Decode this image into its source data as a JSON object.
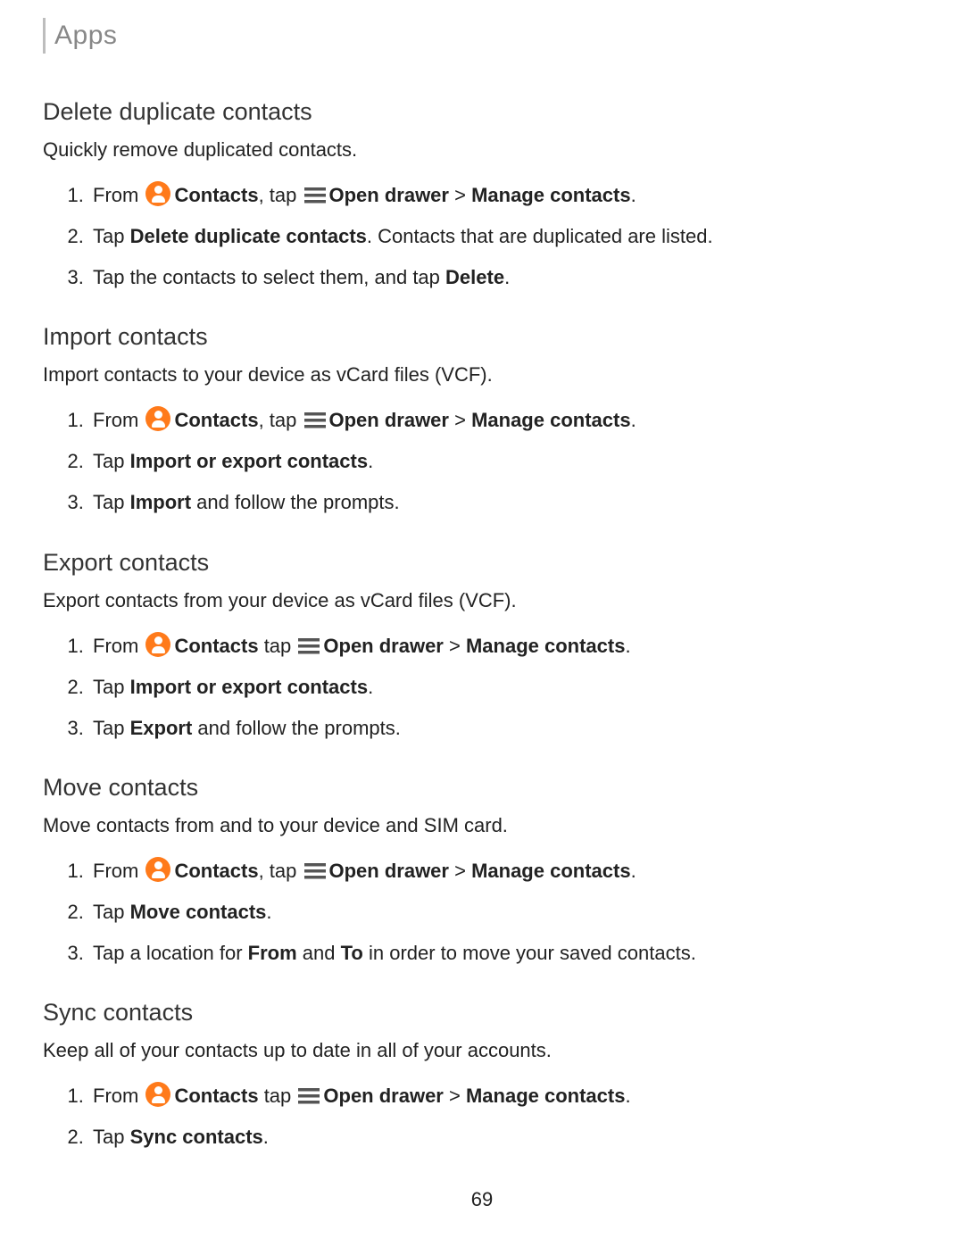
{
  "header": "Apps",
  "pageNumber": "69",
  "icons": {
    "contacts": "contacts-icon",
    "drawer": "drawer-icon"
  },
  "sections": [
    {
      "id": "delete-duplicates",
      "title": "Delete duplicate contacts",
      "desc": "Quickly remove duplicated contacts.",
      "steps": [
        [
          {
            "t": "From "
          },
          {
            "icon": "contacts"
          },
          {
            "t": "Contacts",
            "b": true
          },
          {
            "t": ", tap "
          },
          {
            "icon": "drawer"
          },
          {
            "t": "Open drawer",
            "b": true
          },
          {
            "t": " > "
          },
          {
            "t": "Manage contacts",
            "b": true
          },
          {
            "t": "."
          }
        ],
        [
          {
            "t": "Tap "
          },
          {
            "t": "Delete duplicate contacts",
            "b": true
          },
          {
            "t": ". Contacts that are duplicated are listed."
          }
        ],
        [
          {
            "t": "Tap the contacts to select them, and tap "
          },
          {
            "t": "Delete",
            "b": true
          },
          {
            "t": "."
          }
        ]
      ]
    },
    {
      "id": "import",
      "title": "Import contacts",
      "desc": "Import contacts to your device as vCard files (VCF).",
      "steps": [
        [
          {
            "t": "From "
          },
          {
            "icon": "contacts"
          },
          {
            "t": "Contacts",
            "b": true
          },
          {
            "t": ", tap "
          },
          {
            "icon": "drawer"
          },
          {
            "t": "Open drawer",
            "b": true
          },
          {
            "t": " > "
          },
          {
            "t": "Manage contacts",
            "b": true
          },
          {
            "t": "."
          }
        ],
        [
          {
            "t": "Tap "
          },
          {
            "t": "Import or export contacts",
            "b": true
          },
          {
            "t": "."
          }
        ],
        [
          {
            "t": "Tap "
          },
          {
            "t": "Import",
            "b": true
          },
          {
            "t": " and follow the prompts."
          }
        ]
      ]
    },
    {
      "id": "export",
      "title": "Export contacts",
      "desc": "Export contacts from your device as vCard files (VCF).",
      "steps": [
        [
          {
            "t": "From "
          },
          {
            "icon": "contacts"
          },
          {
            "t": "Contacts",
            "b": true
          },
          {
            "t": " tap "
          },
          {
            "icon": "drawer"
          },
          {
            "t": "Open drawer",
            "b": true
          },
          {
            "t": " > "
          },
          {
            "t": "Manage contacts",
            "b": true
          },
          {
            "t": "."
          }
        ],
        [
          {
            "t": "Tap "
          },
          {
            "t": "Import or export contacts",
            "b": true
          },
          {
            "t": "."
          }
        ],
        [
          {
            "t": "Tap "
          },
          {
            "t": "Export",
            "b": true
          },
          {
            "t": " and follow the prompts."
          }
        ]
      ]
    },
    {
      "id": "move",
      "title": "Move contacts",
      "desc": "Move contacts from and to your device and SIM card.",
      "steps": [
        [
          {
            "t": "From "
          },
          {
            "icon": "contacts"
          },
          {
            "t": "Contacts",
            "b": true
          },
          {
            "t": ", tap "
          },
          {
            "icon": "drawer"
          },
          {
            "t": "Open drawer",
            "b": true
          },
          {
            "t": " > "
          },
          {
            "t": "Manage contacts",
            "b": true
          },
          {
            "t": "."
          }
        ],
        [
          {
            "t": "Tap "
          },
          {
            "t": "Move contacts",
            "b": true
          },
          {
            "t": "."
          }
        ],
        [
          {
            "t": "Tap a location for "
          },
          {
            "t": "From",
            "b": true
          },
          {
            "t": " and "
          },
          {
            "t": "To",
            "b": true
          },
          {
            "t": " in order to move your saved contacts."
          }
        ]
      ]
    },
    {
      "id": "sync",
      "title": "Sync contacts",
      "desc": "Keep all of your contacts up to date in all of your accounts.",
      "steps": [
        [
          {
            "t": "From "
          },
          {
            "icon": "contacts"
          },
          {
            "t": "Contacts",
            "b": true
          },
          {
            "t": " tap "
          },
          {
            "icon": "drawer"
          },
          {
            "t": "Open drawer",
            "b": true
          },
          {
            "t": " > "
          },
          {
            "t": "Manage contacts",
            "b": true
          },
          {
            "t": "."
          }
        ],
        [
          {
            "t": "Tap "
          },
          {
            "t": "Sync contacts",
            "b": true
          },
          {
            "t": "."
          }
        ]
      ]
    }
  ]
}
